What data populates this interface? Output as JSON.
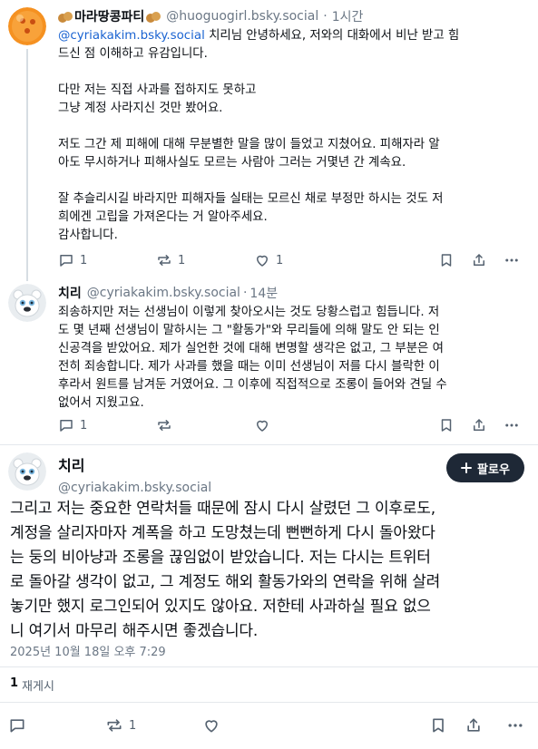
{
  "post1": {
    "display_name": "마라땅콩파티",
    "handle": "@huoguogirl.bsky.social",
    "separator": "·",
    "time": "1시간",
    "mention": "@cyriakakim.bsky.social",
    "text_after_mention": " 치리님 안녕하세요, 저와의 대화에서 비난 받고 힘\n드신 점 이해하고 유감입니다.\n\n다만 저는 직접 사과를 접하지도 못하고\n그냥 계정 사라지신 것만 봤어요.\n\n저도 그간 제 피해에 대해 무분별한 말을 많이 들었고 지쳤어요. 피해자라 알\n아도 무시하거나 피해사실도 모르는 사람아 그러는 거몇년 간 계속요.\n\n잘 추슬리시길 바라지만 피해자들 실태는 모르신 채로 부정만 하시는 것도 저\n희에겐 고립을 가져온다는 거 알아주세요.\n감사합니다.",
    "reply_count": "1",
    "repost_count": "1",
    "like_count": "1"
  },
  "post2": {
    "display_name": "치리",
    "handle": "@cyriakakim.bsky.social",
    "separator": "·",
    "time": "14분",
    "text": "죄송하지만 저는 선생님이 이렇게 찾아오시는 것도 당황스럽고 힘듭니다. 저\n도 몇 년째 선생님이 말하시는 그 \"활동가\"와 무리들에 의해 말도 안 되는 인\n신공격을 받았어요. 제가 실언한 것에 대해 변명할 생각은 없고, 그 부분은 여\n전히 죄송합니다. 제가 사과를 했을 때는 이미 선생님이 저를 다시 블락한 이\n후라서 원트를 남겨둔 거였어요. 그 이후에 직접적으로 조롱이 들어와 견딜 수\n없어서 지웠고요.",
    "reply_count": "1",
    "repost_count": ""
  },
  "post3": {
    "display_name": "치리",
    "handle": "@cyriakakim.bsky.social",
    "follow_label": "팔로우",
    "text": "그리고 저는 중요한 연락처들 때문에 잠시 다시 살렸던 그 이후로도,\n계정을 살리자마자 계폭을 하고 도망쳤는데 뻔뻔하게 다시 돌아왔다\n는 둥의 비아냥과 조롱을 끊임없이 받았습니다. 저는 다시는 트위터\n로 돌아갈 생각이 없고, 그 계정도 해외 활동가와의 연락을 위해 살려\n놓기만 했지 로그인되어 있지도 않아요. 저한테 사과하실 필요 없으\n니 여기서 마무리 해주시면 좋겠습니다.",
    "timestamp": "2025년 10월 18일 오후 7:29",
    "repost_total": "1",
    "repost_total_label": "재게시",
    "repost_count": "1"
  },
  "icons": {
    "peanut": "peanut-emoji",
    "reply": "speech-bubble-icon",
    "repost": "repost-arrows-icon",
    "like": "heart-icon",
    "bookmark": "bookmark-icon",
    "share": "share-icon",
    "more": "more-dots-icon",
    "plus": "plus-icon"
  },
  "colors": {
    "mention": "#1a63d1",
    "follow_button": "#1e2836",
    "muted": "#6b7785",
    "avatar1": "#f28c1e"
  }
}
